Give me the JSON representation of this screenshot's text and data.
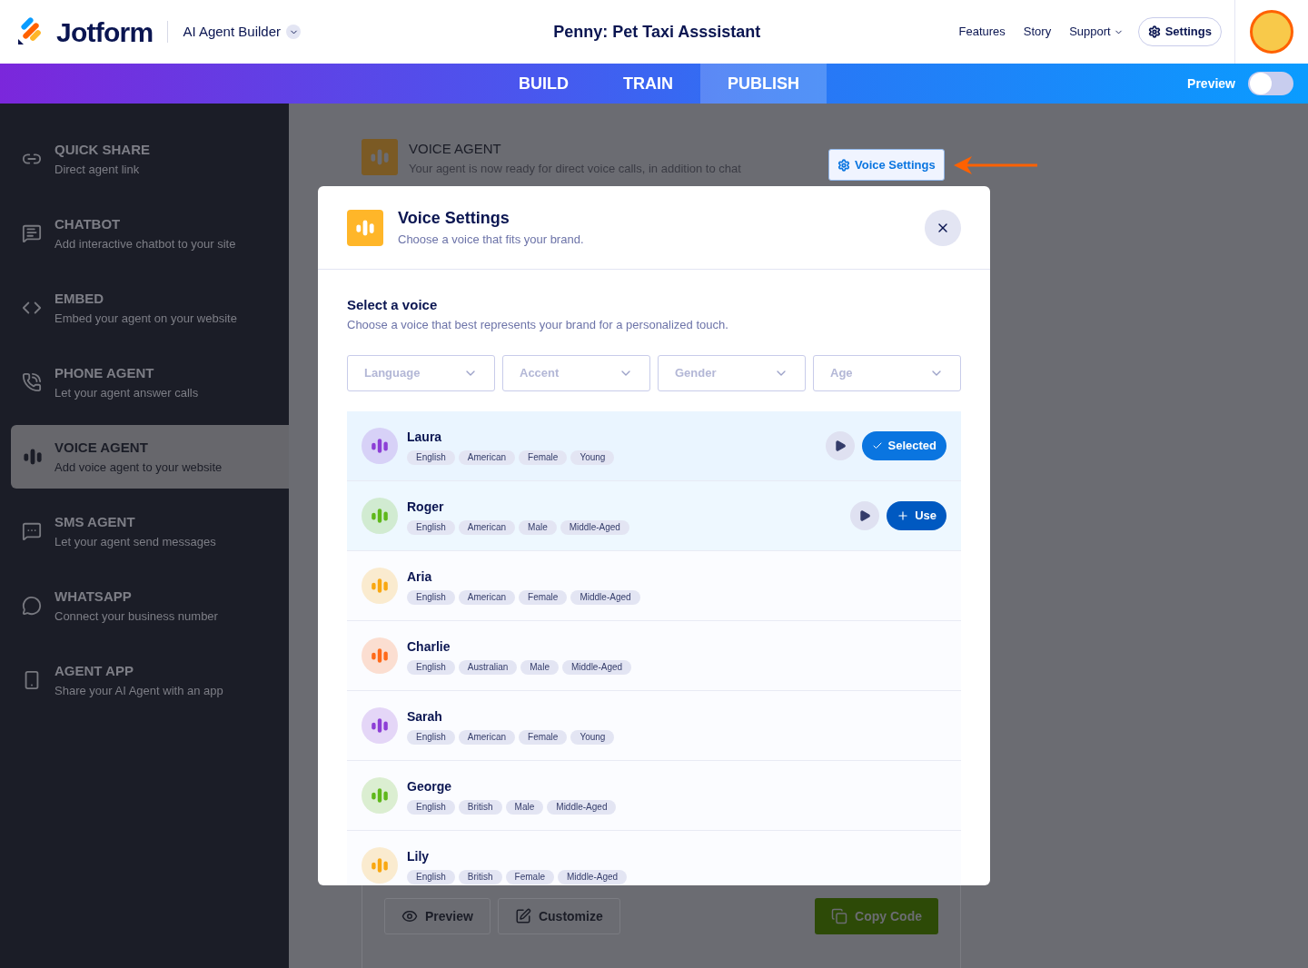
{
  "header": {
    "logo": "Jotform",
    "product": "AI Agent Builder",
    "title": "Penny: Pet Taxi Asssistant",
    "links": [
      {
        "label": "Features",
        "dropdown": false
      },
      {
        "label": "Story",
        "dropdown": false
      },
      {
        "label": "Support",
        "dropdown": true
      }
    ],
    "settings_button": "Settings"
  },
  "nav": {
    "tabs": [
      {
        "label": "BUILD",
        "selected": false
      },
      {
        "label": "TRAIN",
        "selected": false
      },
      {
        "label": "PUBLISH",
        "selected": true
      }
    ],
    "preview": {
      "label": "Preview",
      "on": false
    }
  },
  "sidebar": {
    "items": [
      {
        "title": "QUICK SHARE",
        "subtitle": "Direct agent link",
        "selected": false
      },
      {
        "title": "CHATBOT",
        "subtitle": "Add interactive chatbot to your site",
        "selected": false
      },
      {
        "title": "EMBED",
        "subtitle": "Embed your agent on your website",
        "selected": false
      },
      {
        "title": "PHONE AGENT",
        "subtitle": "Let your agent answer calls",
        "selected": false
      },
      {
        "title": "VOICE AGENT",
        "subtitle": "Add voice agent to your website",
        "selected": true
      },
      {
        "title": "SMS AGENT",
        "subtitle": "Let your agent send messages",
        "selected": false
      },
      {
        "title": "WHATSAPP",
        "subtitle": "Connect your business number",
        "selected": false
      },
      {
        "title": "AGENT APP",
        "subtitle": "Share your AI Agent with an app",
        "selected": false
      }
    ]
  },
  "page": {
    "title": "VOICE AGENT",
    "subtitle": "Your agent is now ready for direct voice calls, in addition to chat",
    "voice_settings_button": "Voice Settings",
    "buttons": [
      {
        "label": "Preview",
        "kind": "preview"
      },
      {
        "label": "Customize",
        "kind": "customize"
      },
      {
        "label": "Copy Code",
        "kind": "copy"
      }
    ]
  },
  "modal": {
    "title": "Voice Settings",
    "subtitle": "Choose a voice that fits your brand.",
    "section_title": "Select a voice",
    "section_subtitle": "Choose a voice that best represents your brand for a personalized touch.",
    "filters": [
      {
        "placeholder": "Language"
      },
      {
        "placeholder": "Accent"
      },
      {
        "placeholder": "Gender"
      },
      {
        "placeholder": "Age"
      }
    ],
    "voices": [
      {
        "name": "Laura",
        "tags": [
          "English",
          "American",
          "Female",
          "Young"
        ],
        "color": "#8d3fd6",
        "selected": true,
        "button": "Selected"
      },
      {
        "name": "Roger",
        "tags": [
          "English",
          "American",
          "Male",
          "Middle-Aged"
        ],
        "color": "#5fb81b",
        "selected": false,
        "button": "Use"
      },
      {
        "name": "Aria",
        "tags": [
          "English",
          "American",
          "Female",
          "Middle-Aged"
        ],
        "color": "#f9a811",
        "selected": false
      },
      {
        "name": "Charlie",
        "tags": [
          "English",
          "Australian",
          "Male",
          "Middle-Aged"
        ],
        "color": "#ff6a1a",
        "selected": false
      },
      {
        "name": "Sarah",
        "tags": [
          "English",
          "American",
          "Female",
          "Young"
        ],
        "color": "#8d3fd6",
        "selected": false
      },
      {
        "name": "George",
        "tags": [
          "English",
          "British",
          "Male",
          "Middle-Aged"
        ],
        "color": "#5fb81b",
        "selected": false
      },
      {
        "name": "Lily",
        "tags": [
          "English",
          "British",
          "Female",
          "Middle-Aged"
        ],
        "color": "#f9a811",
        "selected": false
      }
    ]
  }
}
